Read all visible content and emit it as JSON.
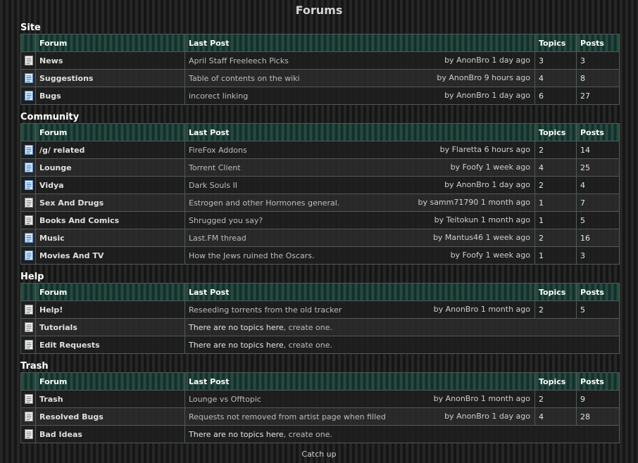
{
  "page": {
    "title": "Forums",
    "catchup_label": "Catch up"
  },
  "headers": {
    "forum": "Forum",
    "last_post": "Last Post",
    "topics": "Topics",
    "posts": "Posts"
  },
  "sections": [
    {
      "title": "Site",
      "rows": [
        {
          "name": "News",
          "last_title": "April Staff Freeleech Picks",
          "meta": "by AnonBro 1 day ago",
          "topics": "3",
          "posts": "3"
        },
        {
          "name": "Suggestions",
          "last_title": "Table of contents on the wiki",
          "meta": "by AnonBro 9 hours ago",
          "topics": "4",
          "posts": "8"
        },
        {
          "name": "Bugs",
          "last_title": "incorect linking",
          "meta": "by AnonBro 1 day ago",
          "topics": "6",
          "posts": "27"
        }
      ]
    },
    {
      "title": "Community",
      "rows": [
        {
          "name": "/g/ related",
          "last_title": "FireFox Addons",
          "meta": "by Flaretta 6 hours ago",
          "topics": "2",
          "posts": "14"
        },
        {
          "name": "Lounge",
          "last_title": "Torrent Client",
          "meta": "by Foofy 1 week ago",
          "topics": "4",
          "posts": "25"
        },
        {
          "name": "Vidya",
          "last_title": "Dark Souls II",
          "meta": "by AnonBro 1 day ago",
          "topics": "2",
          "posts": "4"
        },
        {
          "name": "Sex And Drugs",
          "last_title": "Estrogen and other Hormones general.",
          "meta": "by samm71790 1 month ago",
          "topics": "1",
          "posts": "7"
        },
        {
          "name": "Books And Comics",
          "last_title": "Shrugged you say?",
          "meta": "by Teitokun 1 month ago",
          "topics": "1",
          "posts": "5"
        },
        {
          "name": "Music",
          "last_title": "Last.FM thread",
          "meta": "by Mantus46 1 week ago",
          "topics": "2",
          "posts": "16"
        },
        {
          "name": "Movies And TV",
          "last_title": "How the Jews ruined the Oscars.",
          "meta": "by Foofy 1 week ago",
          "topics": "1",
          "posts": "3"
        }
      ]
    },
    {
      "title": "Help",
      "rows": [
        {
          "name": "Help!",
          "last_title": "Reseeding torrents from the old tracker",
          "meta": "by AnonBro 1 month ago",
          "topics": "2",
          "posts": "5"
        },
        {
          "name": "Tutorials",
          "empty": "There are no topics here",
          "create": ", create one."
        },
        {
          "name": "Edit Requests",
          "empty": "There are no topics here",
          "create": ", create one."
        }
      ]
    },
    {
      "title": "Trash",
      "rows": [
        {
          "name": "Trash",
          "last_title": "Lounge vs Offtopic",
          "meta": "by AnonBro 1 month ago",
          "topics": "2",
          "posts": "9"
        },
        {
          "name": "Resolved Bugs",
          "last_title": "Requests not removed from artist page when filled",
          "meta": "by AnonBro 1 day ago",
          "topics": "4",
          "posts": "28"
        },
        {
          "name": "Bad Ideas",
          "empty": "There are no topics here",
          "create": ", create one."
        }
      ]
    }
  ]
}
